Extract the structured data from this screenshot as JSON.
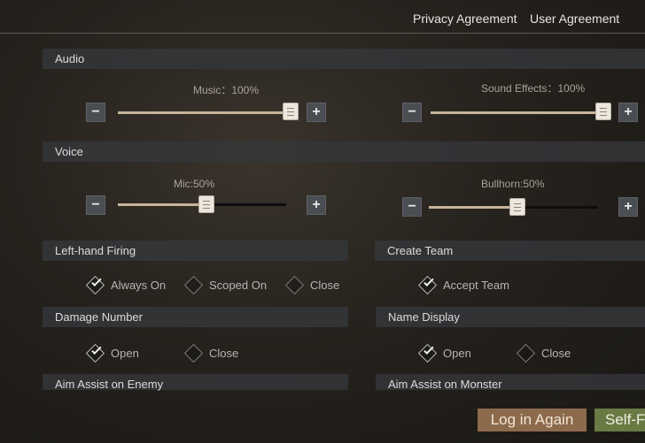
{
  "header": {
    "privacy_link": "Privacy Agreement",
    "user_link": "User Agreement"
  },
  "audio": {
    "title": "Audio",
    "music": {
      "label": "Music：100%",
      "value": 100
    },
    "sound_effects": {
      "label": "Sound Effects：100%",
      "value": 100
    }
  },
  "voice": {
    "title": "Voice",
    "mic": {
      "label": "Mic:50%",
      "value": 50
    },
    "bullhorn": {
      "label": "Bullhorn:50%",
      "value": 50
    }
  },
  "controls": {
    "minus": "−",
    "plus": "+"
  },
  "left_hand_firing": {
    "title": "Left-hand Firing",
    "options": [
      "Always On",
      "Scoped On",
      "Close"
    ],
    "selected": 0
  },
  "create_team": {
    "title": "Create Team",
    "options": [
      "Accept Team"
    ],
    "selected": 0
  },
  "damage_number": {
    "title": "Damage Number",
    "options": [
      "Open",
      "Close"
    ],
    "selected": 0
  },
  "name_display": {
    "title": "Name Display",
    "options": [
      "Open",
      "Close"
    ],
    "selected": 0
  },
  "aim_assist_enemy": {
    "title": "Aim Assist on Enemy"
  },
  "aim_assist_monster": {
    "title": "Aim Assist on Monster"
  },
  "buttons": {
    "log_in_again": "Log in Again",
    "self": "Self-F"
  },
  "colors": {
    "slider_fill": "#c8b49a",
    "login_button": "#8c6a4c",
    "self_button": "#6a7a44"
  }
}
